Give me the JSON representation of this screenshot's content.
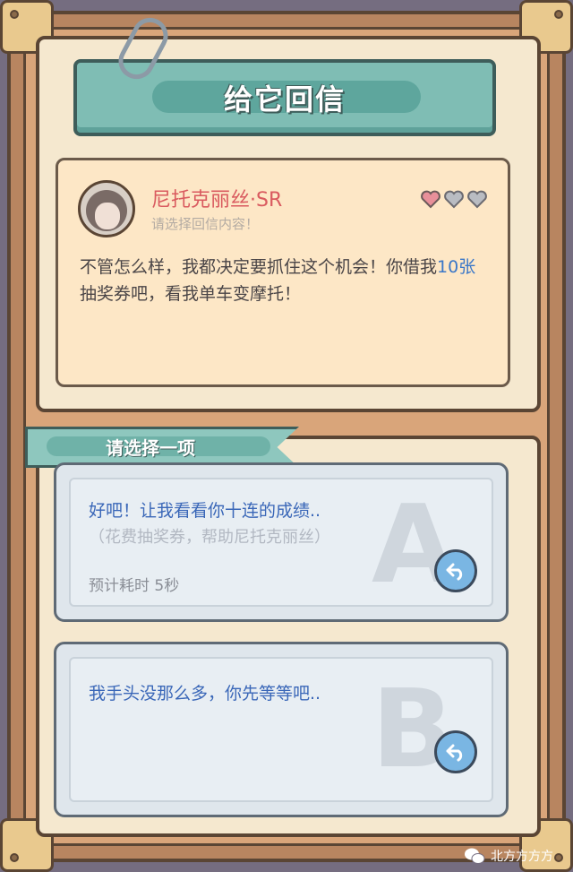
{
  "header": {
    "title": "给它回信"
  },
  "letter": {
    "name": "尼托克丽丝·SR",
    "subtitle": "请选择回信内容！",
    "hearts_total": 3,
    "hearts_filled": 1,
    "body_part1": "不管怎么样，我都决定要抓住这个机会！你借我",
    "body_highlight": "10张",
    "body_part2": "抽奖券吧，看我单车变摩托！"
  },
  "choose": {
    "label": "请选择一项"
  },
  "options": [
    {
      "letter": "A",
      "text": "好吧！让我看看你十连的成绩..",
      "note": "（花费抽奖券，帮助尼托克丽丝）",
      "time": "预计耗时  5秒"
    },
    {
      "letter": "B",
      "text": "我手头没那么多，你先等等吧.."
    }
  ],
  "watermark": {
    "text": "北方方方方"
  },
  "colors": {
    "heart_filled": "#e8909a",
    "heart_empty": "#b9bcc2",
    "accent_blue": "#3a67b8",
    "name_red": "#d95a5f"
  }
}
